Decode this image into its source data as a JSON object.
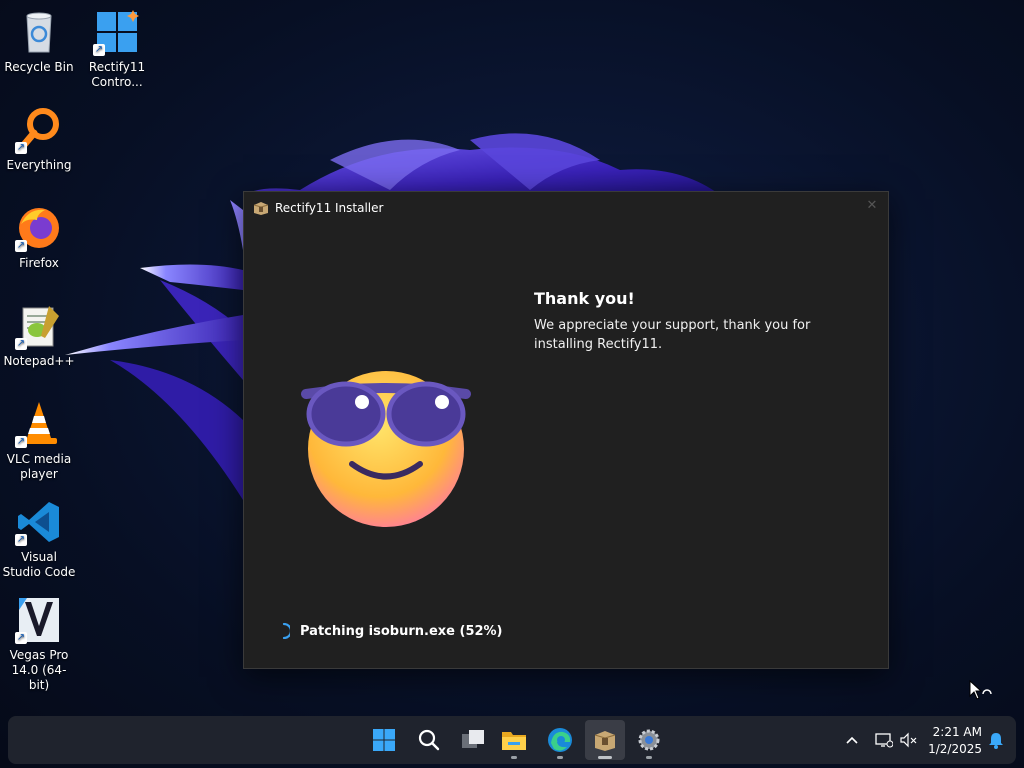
{
  "desktop": {
    "icons": [
      {
        "label": "Recycle Bin",
        "icon": "recycle-bin-icon"
      },
      {
        "label": "Rectify11 Contro...",
        "icon": "windows-logo-icon"
      },
      {
        "label": "Everything",
        "icon": "magnifier-icon"
      },
      {
        "label": "Firefox",
        "icon": "firefox-icon"
      },
      {
        "label": "Notepad++",
        "icon": "notepad-plus-icon"
      },
      {
        "label": "VLC media player",
        "icon": "vlc-cone-icon"
      },
      {
        "label": "Visual Studio Code",
        "icon": "vscode-icon"
      },
      {
        "label": "Vegas Pro 14.0 (64-bit)",
        "icon": "vegas-pro-icon"
      }
    ]
  },
  "installer": {
    "title": "Rectify11 Installer",
    "heading": "Thank you!",
    "message": "We appreciate your support, thank you for installing Rectify11.",
    "status": "Patching isoburn.exe (52%)",
    "progress_percent": 52
  },
  "taskbar": {
    "apps": [
      "start-icon",
      "search-icon",
      "task-view-icon",
      "file-explorer-icon",
      "edge-icon",
      "installer-icon",
      "settings-icon"
    ],
    "clock_time": "2:21 AM",
    "clock_date": "1/2/2025"
  },
  "colors": {
    "accent": "#0078d4",
    "window_bg": "#202020",
    "taskbar_bg": "#20242e"
  }
}
